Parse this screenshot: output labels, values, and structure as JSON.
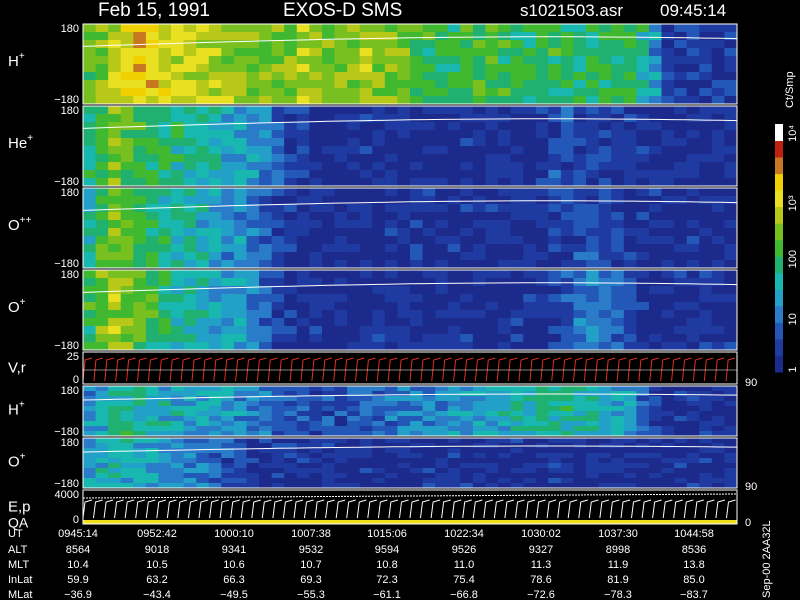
{
  "header": {
    "date": "Feb 15, 1991",
    "mission": "EXOS-D SMS",
    "file": "s1021503.asr",
    "time": "09:45:14"
  },
  "colorbar": {
    "unit": "Ct/Smp",
    "ticks": [
      "10⁴",
      "10³",
      "100",
      "10",
      "1"
    ]
  },
  "panels": [
    {
      "label": "H+",
      "ion": "H",
      "charge": "+",
      "ytop": "180",
      "ybot": "−180",
      "color_level": [
        0.55,
        0.6,
        0.7,
        0.75,
        0.8,
        0.78,
        0.75,
        0.72,
        0.7,
        0.68,
        0.66,
        0.64,
        0.62,
        0.6,
        0.6,
        0.6,
        0.62,
        0.65,
        0.62,
        0.6,
        0.6,
        0.62,
        0.64,
        0.62,
        0.6,
        0.58,
        0.55,
        0.5,
        0.48,
        0.48,
        0.5,
        0.52,
        0.5,
        0.5,
        0.48,
        0.5,
        0.52,
        0.5,
        0.48,
        0.45,
        0.48,
        0.5,
        0.48,
        0.45,
        0.42,
        0.3,
        0.1,
        0.1,
        0.1,
        0.1,
        0.1,
        0.1
      ]
    },
    {
      "label": "He+",
      "ion": "He",
      "charge": "+",
      "ytop": "180",
      "ybot": "−180",
      "color_level": [
        0.45,
        0.5,
        0.6,
        0.55,
        0.5,
        0.48,
        0.45,
        0.42,
        0.4,
        0.38,
        0.36,
        0.35,
        0.33,
        0.3,
        0.25,
        0.2,
        0.1,
        0.08,
        0.06,
        0.06,
        0.06,
        0.06,
        0.08,
        0.06,
        0.06,
        0.06,
        0.06,
        0.06,
        0.06,
        0.06,
        0.06,
        0.06,
        0.06,
        0.06,
        0.06,
        0.06,
        0.1,
        0.14,
        0.14,
        0.12,
        0.12,
        0.1,
        0.1,
        0.08,
        0.08,
        0.06,
        0.06,
        0.06,
        0.06,
        0.06,
        0.06,
        0.06
      ]
    },
    {
      "label": "O++",
      "ion": "O",
      "charge": "++",
      "ytop": "180",
      "ybot": "−180",
      "color_level": [
        0.4,
        0.55,
        0.6,
        0.55,
        0.5,
        0.45,
        0.42,
        0.4,
        0.38,
        0.36,
        0.34,
        0.3,
        0.28,
        0.25,
        0.2,
        0.12,
        0.08,
        0.06,
        0.06,
        0.06,
        0.06,
        0.06,
        0.06,
        0.06,
        0.06,
        0.06,
        0.06,
        0.06,
        0.06,
        0.06,
        0.06,
        0.06,
        0.06,
        0.06,
        0.06,
        0.06,
        0.06,
        0.1,
        0.12,
        0.14,
        0.14,
        0.12,
        0.1,
        0.1,
        0.08,
        0.06,
        0.06,
        0.06,
        0.06,
        0.06,
        0.06,
        0.06
      ]
    },
    {
      "label": "O+",
      "ion": "O",
      "charge": "+",
      "ytop": "180",
      "ybot": "−180",
      "color_level": [
        0.5,
        0.6,
        0.65,
        0.6,
        0.55,
        0.5,
        0.45,
        0.42,
        0.4,
        0.38,
        0.35,
        0.32,
        0.3,
        0.25,
        0.2,
        0.12,
        0.08,
        0.06,
        0.06,
        0.06,
        0.06,
        0.06,
        0.06,
        0.06,
        0.06,
        0.06,
        0.06,
        0.06,
        0.06,
        0.06,
        0.06,
        0.06,
        0.06,
        0.06,
        0.06,
        0.06,
        0.06,
        0.12,
        0.18,
        0.22,
        0.24,
        0.22,
        0.2,
        0.16,
        0.1,
        0.06,
        0.06,
        0.06,
        0.06,
        0.06,
        0.06,
        0.06
      ]
    },
    {
      "label": "V,r",
      "ion": "V,r",
      "charge": "",
      "ytop": "25",
      "ybot": "0",
      "right": "90"
    },
    {
      "label": "H+",
      "ion": "H",
      "charge": "+",
      "ytop": "180",
      "ybot": "−180",
      "color_level": [
        0.3,
        0.35,
        0.4,
        0.42,
        0.4,
        0.38,
        0.36,
        0.35,
        0.34,
        0.33,
        0.32,
        0.3,
        0.28,
        0.25,
        0.22,
        0.2,
        0.18,
        0.16,
        0.15,
        0.14,
        0.14,
        0.16,
        0.18,
        0.2,
        0.22,
        0.24,
        0.25,
        0.26,
        0.28,
        0.3,
        0.3,
        0.32,
        0.34,
        0.35,
        0.36,
        0.38,
        0.4,
        0.42,
        0.42,
        0.4,
        0.38,
        0.36,
        0.34,
        0.3,
        0.2,
        0.1,
        0.06,
        0.06,
        0.06,
        0.06,
        0.06,
        0.06
      ]
    },
    {
      "label": "O+",
      "ion": "O",
      "charge": "+",
      "ytop": "180",
      "ybot": "−180",
      "right": "90",
      "color_level": [
        0.3,
        0.35,
        0.38,
        0.36,
        0.34,
        0.32,
        0.3,
        0.28,
        0.26,
        0.24,
        0.2,
        0.15,
        0.1,
        0.06,
        0.06,
        0.06,
        0.06,
        0.06,
        0.06,
        0.06,
        0.06,
        0.06,
        0.06,
        0.06,
        0.06,
        0.06,
        0.06,
        0.06,
        0.06,
        0.06,
        0.06,
        0.06,
        0.06,
        0.06,
        0.06,
        0.06,
        0.06,
        0.06,
        0.06,
        0.06,
        0.06,
        0.06,
        0.06,
        0.06,
        0.06,
        0.06,
        0.06,
        0.06,
        0.06,
        0.06,
        0.06,
        0.06
      ]
    },
    {
      "label": "E,p",
      "label2": "QA",
      "ion": "E,p",
      "charge": "",
      "ytop": "4000",
      "ybot": "0",
      "right": "0"
    }
  ],
  "footer": {
    "rows": [
      {
        "name": "UT",
        "values": [
          "0945:14",
          "0952:42",
          "1000:10",
          "1007:38",
          "1015:06",
          "1022:34",
          "1030:02",
          "1037:30",
          "1044:58"
        ]
      },
      {
        "name": "ALT",
        "values": [
          "8564",
          "9018",
          "9341",
          "9532",
          "9594",
          "9526",
          "9327",
          "8998",
          "8536"
        ]
      },
      {
        "name": "MLT",
        "values": [
          "10.4",
          "10.5",
          "10.6",
          "10.7",
          "10.8",
          "11.0",
          "11.3",
          "11.9",
          "13.8"
        ]
      },
      {
        "name": "InLat",
        "values": [
          "59.9",
          "63.2",
          "66.3",
          "69.3",
          "72.3",
          "75.4",
          "78.6",
          "81.9",
          "85.0"
        ]
      },
      {
        "name": "MLat",
        "values": [
          "−36.9",
          "−43.4",
          "−49.5",
          "−55.3",
          "−61.1",
          "−66.8",
          "−72.6",
          "−78.3",
          "−83.7"
        ]
      }
    ],
    "side_label": "Sep-00 2AA32L"
  },
  "chart_data": {
    "type": "heatmap",
    "title": "Feb 15, 1991   EXOS-D SMS",
    "xlabel": "UT",
    "x": [
      "0945:14",
      "0952:42",
      "1000:10",
      "1007:38",
      "1015:06",
      "1022:34",
      "1030:02",
      "1037:30",
      "1044:58"
    ],
    "ylabel_panels": [
      "H+",
      "He+",
      "O++",
      "O+",
      "V,r",
      "H+",
      "O+",
      "E,p"
    ],
    "colorbar_unit": "Ct/Smp",
    "colorbar_ticks": [
      "1",
      "10",
      "100",
      "10³",
      "10⁴"
    ]
  }
}
